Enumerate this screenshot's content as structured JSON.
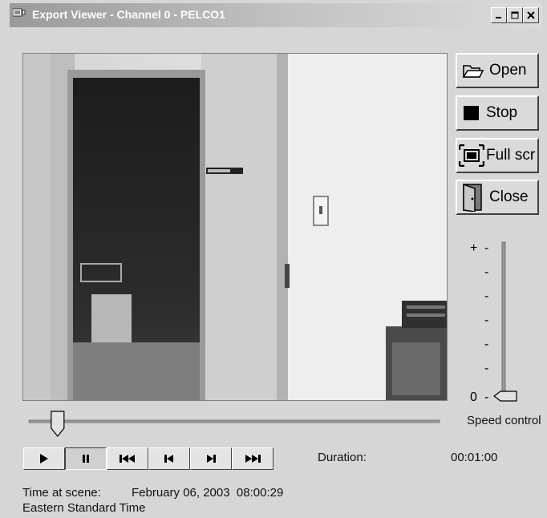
{
  "window": {
    "title": "Export Viewer - Channel 0 - PELCO1",
    "icons": {
      "app": "window-app-icon",
      "minimize": "minimize-icon",
      "maximize": "maximize-icon",
      "close": "close-icon"
    }
  },
  "side_buttons": [
    {
      "label": "Open",
      "icon": "folder-open-icon"
    },
    {
      "label": "Stop",
      "icon": "stop-square-icon"
    },
    {
      "label": "Full scr",
      "icon": "fullscreen-icon"
    },
    {
      "label": "Close",
      "icon": "door-icon"
    }
  ],
  "speed_control": {
    "label": "Speed control",
    "max_marker": "+",
    "min_marker": "0",
    "tick_mark": "-",
    "level": 0
  },
  "seek_bar": {
    "position": 0.07
  },
  "transport": [
    {
      "name": "play",
      "icon": "play-icon",
      "pressed": false
    },
    {
      "name": "pause",
      "icon": "pause-icon",
      "pressed": true
    },
    {
      "name": "skip-to-start",
      "icon": "skip-to-start-icon",
      "pressed": false
    },
    {
      "name": "step-back",
      "icon": "step-back-icon",
      "pressed": false
    },
    {
      "name": "step-forward",
      "icon": "step-forward-icon",
      "pressed": false
    },
    {
      "name": "skip-to-end",
      "icon": "skip-to-end-icon",
      "pressed": false
    }
  ],
  "duration": {
    "label": "Duration:",
    "value": "00:01:00"
  },
  "scene": {
    "label": "Time at scene:",
    "value": "February 06, 2003  08:00:29",
    "timezone": "Eastern Standard Time"
  }
}
